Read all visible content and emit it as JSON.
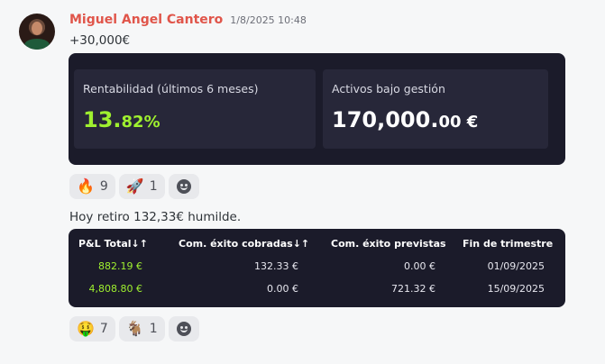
{
  "message": {
    "author": "Miguel Angel Cantero",
    "timestamp": "1/8/2025 10:48",
    "text": "+30,000€"
  },
  "card1": {
    "metric1": {
      "label": "Rentabilidad (últimos 6 meses)",
      "value_int": "13.",
      "value_dec": "82%"
    },
    "metric2": {
      "label": "Activos bajo gestión",
      "value_int": "170,000.",
      "value_dec": "00 €"
    }
  },
  "reactions1": [
    {
      "emoji": "🔥",
      "count": "9"
    },
    {
      "emoji": "🚀",
      "count": "1"
    }
  ],
  "text2": "Hoy retiro 132,33€ humilde.",
  "table": {
    "headers": [
      "P&L Total↓↑",
      "Com. éxito cobradas↓↑",
      "Com. éxito previstas",
      "Fin de trimestre"
    ],
    "rows": [
      [
        "882.19 €",
        "132.33 €",
        "0.00 €",
        "01/09/2025"
      ],
      [
        "4,808.80 €",
        "0.00 €",
        "721.32 €",
        "15/09/2025"
      ]
    ]
  },
  "reactions2": [
    {
      "emoji": "🤑",
      "count": "7"
    },
    {
      "emoji": "🐐",
      "count": "1"
    }
  ],
  "colors": {
    "author": "#e0554a",
    "profit": "#9ff02f",
    "card_bg": "#1b1b2a"
  }
}
